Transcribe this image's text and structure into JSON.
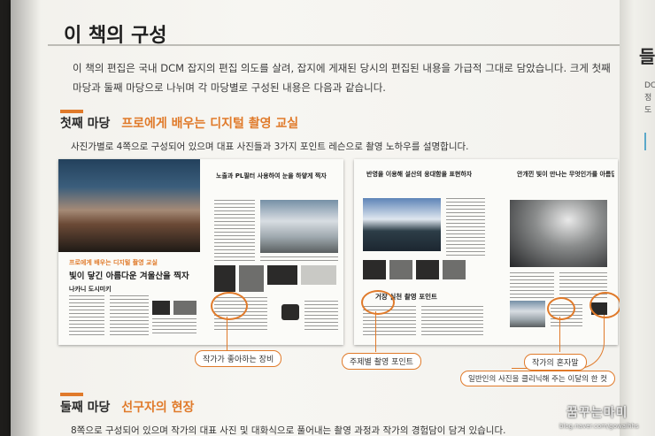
{
  "page": {
    "title": "이 책의 구성",
    "intro": "이 책의 편집은 국내 DCM 잡지의 편집 의도를 살려, 잡지에 게재된 당시의 편집된 내용을 가급적 그대로 담았습니다. 크게 첫째 마당과 둘째 마당으로 나뉘며 각 마당별로 구성된 내용은 다음과 같습니다."
  },
  "section1": {
    "label": "첫째 마당",
    "accent": "프로에게 배우는 디지털 촬영 교실",
    "description": "사진가별로 4쪽으로 구성되어 있으며 대표 사진들과 3가지 포인트 레슨으로 촬영 노하우를 설명합니다."
  },
  "spread_left": {
    "lesson_tag": "프로에게 배우는 디지털 촬영 교실",
    "headline": "빛이 닿긴 아름다운 겨울산을 찍자",
    "author": "나카니 도시미키",
    "page_head": "노출과 PL필터 사용하여 눈을 하얗게 찍자"
  },
  "spread_right": {
    "page_head_left": "반영을 이용해 설산의 웅대함을 표현하자",
    "page_head_right": "안개낀 빛이 만나는 무엇인가를 아름답게 찍자",
    "point_label": "거장 실천 촬영 포인트"
  },
  "callouts": {
    "gear": "작가가 좋아하는 장비",
    "theme_point": "주제별 촬영 포인트",
    "author_note": "작가의 혼자말",
    "one_shot": "일반인의 사진을 클리닉해 주는 이달의 한 컷"
  },
  "section2": {
    "label": "둘째 마당",
    "accent": "선구자의 현장",
    "description": "8쪽으로 구성되어 있으며 작가의 대표 사진 및 대화식으로 풀어내는 촬영 과정과 작가의 경험담이 담겨 있습니다."
  },
  "next_page": {
    "title_fragment": "들",
    "text_fragment": "DC\n정\n도"
  },
  "watermark": {
    "text": "꿈꾸는마미",
    "url": "blog.naver.com/gowaihhs"
  },
  "colors": {
    "accent": "#e07a2a",
    "page_bg": "#f4f3ef"
  }
}
